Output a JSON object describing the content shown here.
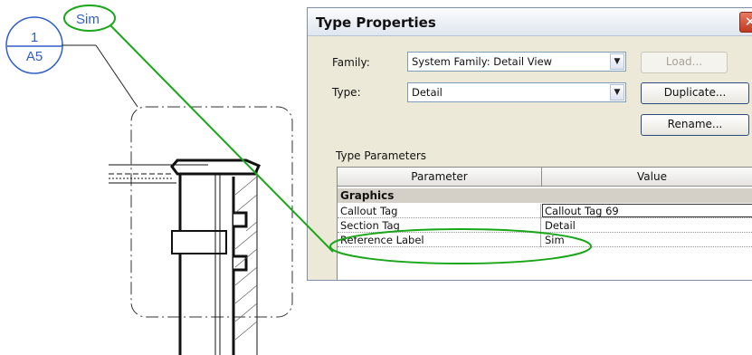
{
  "callout": {
    "reference_label": "Sim",
    "detail_number": "1",
    "sheet_number": "A5"
  },
  "dialog": {
    "title": "Type Properties",
    "close_glyph": "✕",
    "family_label": "Family:",
    "family_value": "System Family: Detail View",
    "type_label": "Type:",
    "type_value": "Detail",
    "buttons": {
      "load": "Load...",
      "duplicate": "Duplicate...",
      "rename": "Rename..."
    },
    "section_label": "Type Parameters",
    "table": {
      "headers": [
        "Parameter",
        "Value"
      ],
      "group": "Graphics",
      "rows": [
        {
          "parameter": "Callout Tag",
          "value": "Callout Tag 69"
        },
        {
          "parameter": "Section Tag",
          "value": "Detail"
        },
        {
          "parameter": "Reference Label",
          "value": "Sim"
        }
      ]
    }
  },
  "colors": {
    "highlight": "#19a619",
    "callout_blue": "#2f5fc7"
  },
  "icons": {
    "dropdown": "chevron-down-icon",
    "close": "close-icon"
  }
}
